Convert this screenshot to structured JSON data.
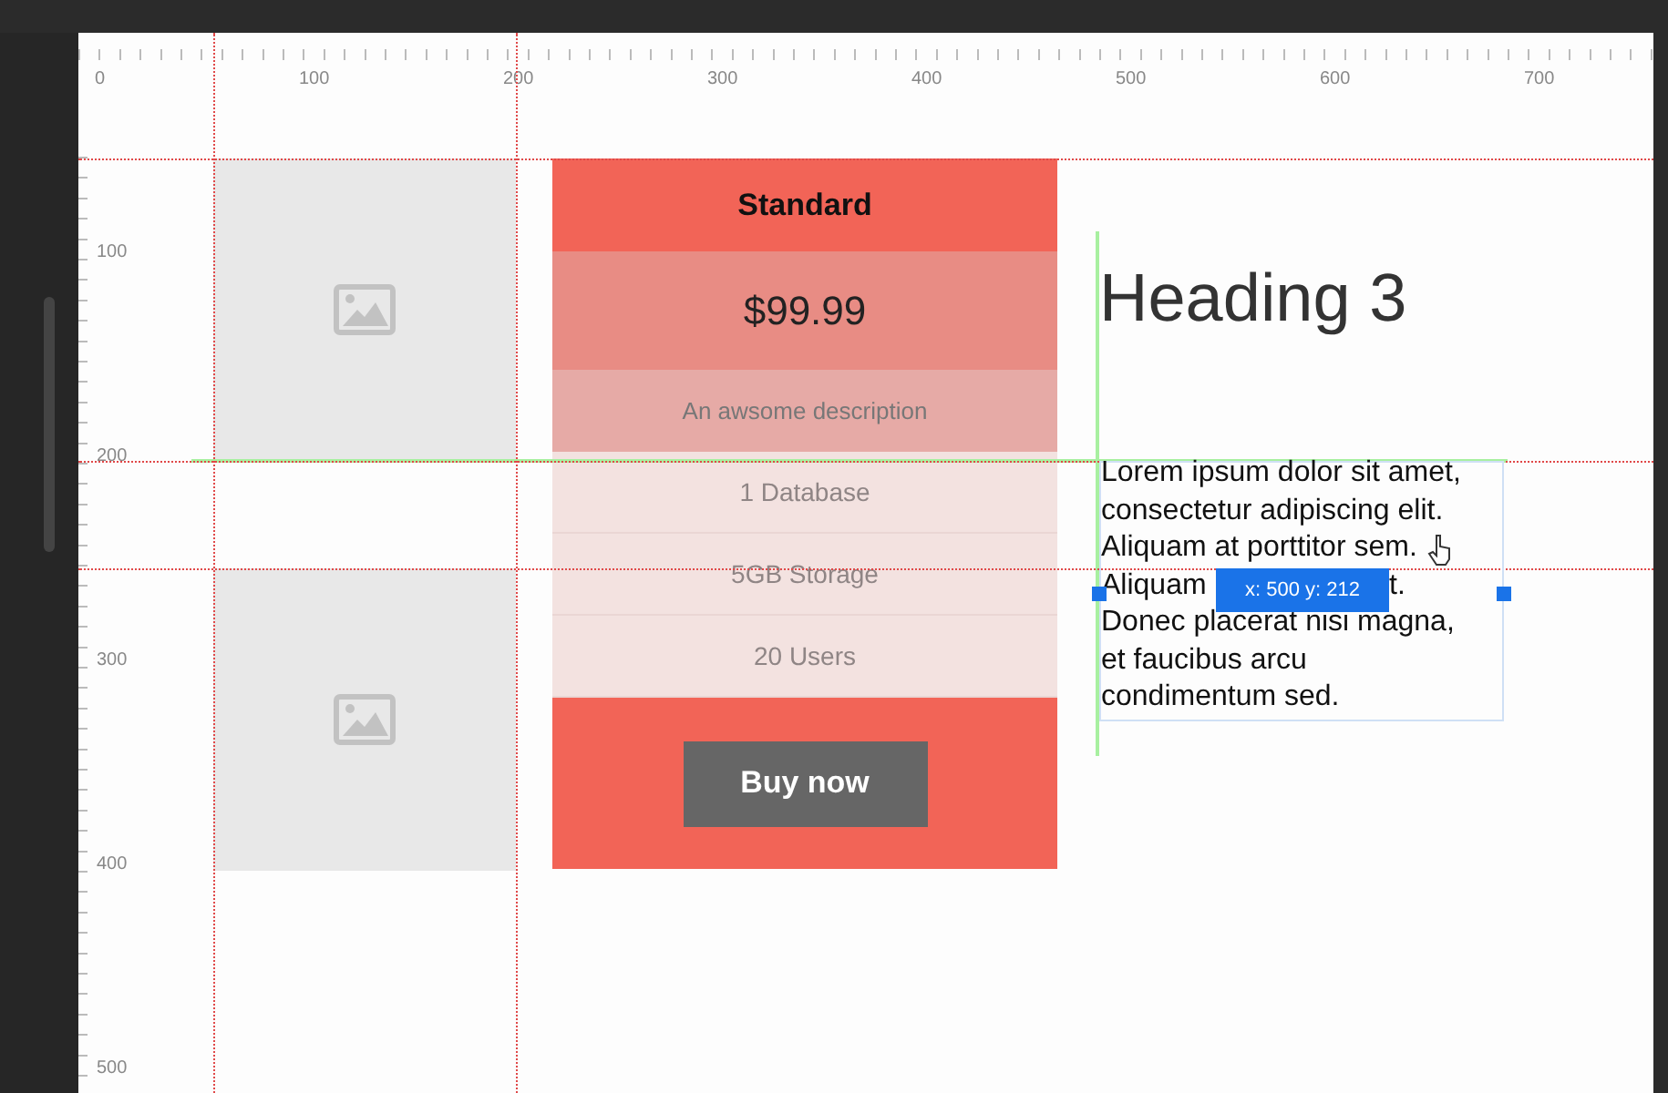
{
  "ruler_horizontal": {
    "labels": [
      "0",
      "100",
      "200",
      "300",
      "400",
      "500",
      "600",
      "700"
    ]
  },
  "ruler_vertical": {
    "labels": [
      "100",
      "200",
      "300",
      "400",
      "500"
    ]
  },
  "image_placeholders": [
    {
      "kind": "image-placeholder"
    },
    {
      "kind": "image-placeholder"
    }
  ],
  "pricing_card": {
    "title": "Standard",
    "price": "$99.99",
    "description": "An awsome description",
    "features": [
      "1 Database",
      "5GB Storage",
      "20 Users"
    ],
    "button": "Buy now"
  },
  "heading": "Heading 3",
  "paragraph": {
    "lines": [
      {
        "text": "Lorem ipsum dolor sit amet,"
      },
      {
        "text": "consectetur adipiscing elit."
      },
      {
        "text": "Aliquam at porttitor sem."
      },
      {
        "text": "Aliquam",
        "tail": "t."
      },
      {
        "text": "Donec placerat nisi magna,"
      },
      {
        "text": "et faucibus arcu"
      },
      {
        "text": "condimentum sed."
      }
    ]
  },
  "tooltip": "x: 500 y: 212"
}
